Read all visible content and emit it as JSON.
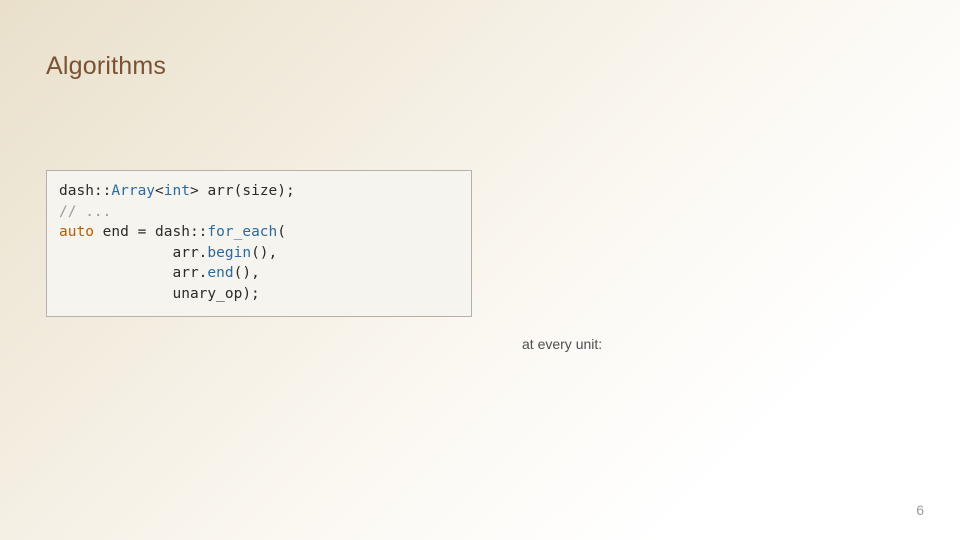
{
  "slide": {
    "title": "Algorithms",
    "page_number": "6"
  },
  "caption": "at every unit:",
  "code": {
    "l1a": "dash::",
    "l1b": "Array",
    "l1c": "<",
    "l1d": "int",
    "l1e": "> arr(size);",
    "l2": "// ...",
    "l3a": "auto",
    "l3b": " end = dash::",
    "l3c": "for_each",
    "l3d": "(",
    "l4a": "             arr.",
    "l4b": "begin",
    "l4c": "(),",
    "l5a": "             arr.",
    "l5b": "end",
    "l5c": "(),",
    "l6": "             unary_op);"
  }
}
